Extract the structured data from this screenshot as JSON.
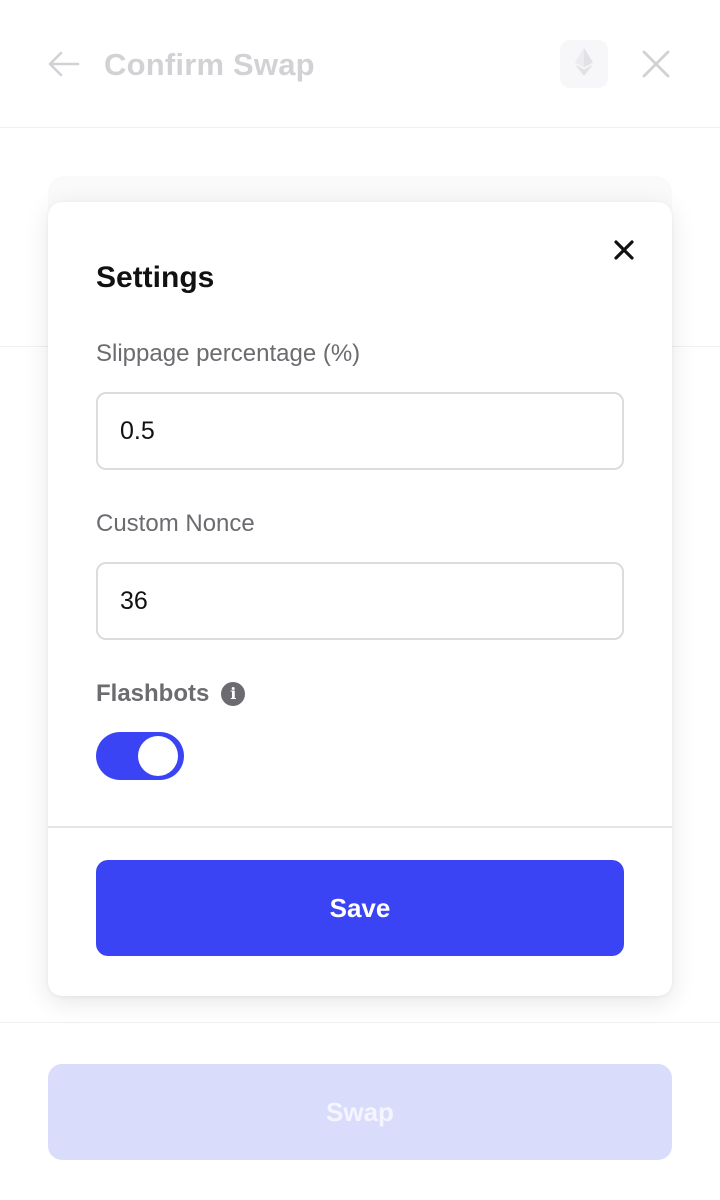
{
  "header": {
    "title": "Confirm Swap",
    "back_icon": "arrow-left-icon",
    "network_icon": "ethereum-icon",
    "close_icon": "close-icon"
  },
  "footer": {
    "swap_label": "Swap"
  },
  "settings_modal": {
    "title": "Settings",
    "close_icon": "close-icon",
    "slippage": {
      "label": "Slippage percentage (%)",
      "value": "0.5"
    },
    "nonce": {
      "label": "Custom Nonce",
      "value": "36"
    },
    "flashbots": {
      "label": "Flashbots",
      "info_icon": "info-icon",
      "enabled": true
    },
    "save_label": "Save"
  },
  "colors": {
    "accent": "#3a44f5",
    "accent_disabled": "#d9dcfb",
    "label_gray": "#6b6b70",
    "text": "#111111"
  }
}
